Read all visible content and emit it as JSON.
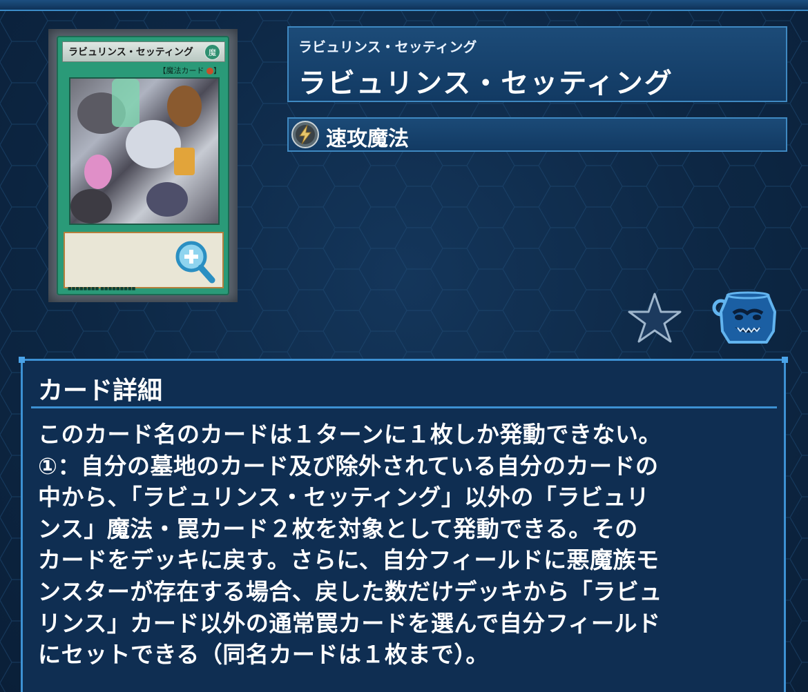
{
  "card": {
    "name_ruby": "ラビュリンス・セッティング",
    "name": "ラビュリンス・セッティング",
    "card_frame_name": "ラビュリンス・セッティング",
    "card_frame_attribute": "魔",
    "card_frame_type": "【魔法カード",
    "spell_type": "速攻魔法",
    "spell_type_icon": "quick-play-spell-icon",
    "frame_color": "#2a9a78"
  },
  "detail": {
    "title": "カード詳細",
    "text": "このカード名のカードは１ターンに１枚しか発動できない。\n①：自分の墓地のカード及び除外されている自分のカードの\n中から、「ラビュリンス・セッティング」以外の「ラビュリ\nンス」魔法・罠カード２枚を対象として発動できる。その\nカードをデッキに戻す。さらに、自分フィールドに悪魔族モ\nンスターが存在する場合、戻した数だけデッキから「ラビュ\nリンス」カード以外の通常罠カードを選んで自分フィールド\nにセットできる（同名カードは１枚まで）。"
  },
  "actions": {
    "zoom_icon": "zoom-in-icon",
    "favorite_icon": "star-icon",
    "pot_icon": "pot-of-greed-icon"
  },
  "colors": {
    "background": "#0e2a49",
    "panel_border": "#3f89c2",
    "accent": "#3d91d3"
  }
}
